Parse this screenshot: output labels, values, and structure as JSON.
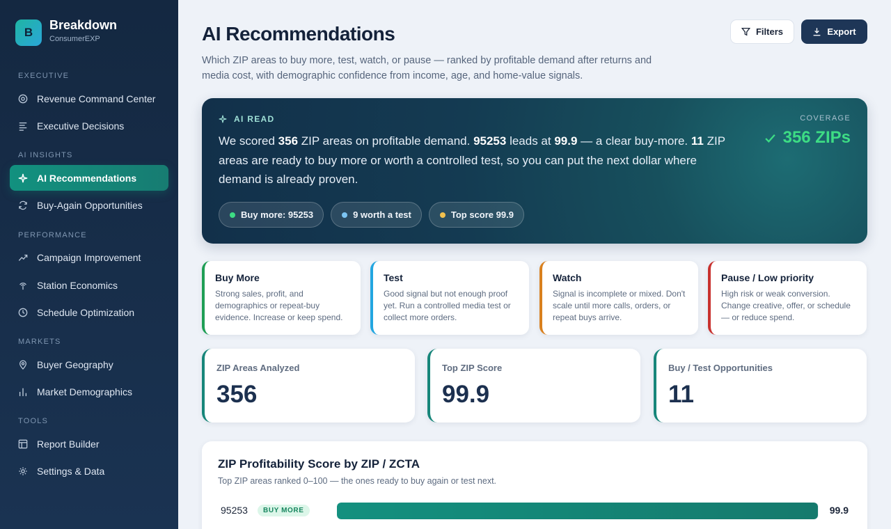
{
  "brand": {
    "initial": "B",
    "name": "Breakdown",
    "sub": "ConsumerEXP"
  },
  "nav": {
    "sections": [
      "Executive",
      "AI Insights",
      "Performance",
      "Markets",
      "Tools"
    ],
    "items": [
      {
        "label": "Revenue Command Center",
        "icon": "target-icon"
      },
      {
        "label": "Executive Decisions",
        "icon": "list-icon"
      },
      {
        "label": "AI Recommendations",
        "icon": "sparkle-icon",
        "active": true
      },
      {
        "label": "Buy-Again Opportunities",
        "icon": "refresh-icon"
      },
      {
        "label": "Campaign Improvement",
        "icon": "trend-icon"
      },
      {
        "label": "Station Economics",
        "icon": "broadcast-icon"
      },
      {
        "label": "Schedule Optimization",
        "icon": "clock-icon"
      },
      {
        "label": "Buyer Geography",
        "icon": "pin-icon"
      },
      {
        "label": "Market Demographics",
        "icon": "bar-chart-icon"
      },
      {
        "label": "Report Builder",
        "icon": "layout-icon"
      },
      {
        "label": "Settings & Data",
        "icon": "gear-icon"
      }
    ]
  },
  "header": {
    "title": "AI Recommendations",
    "description": "Which ZIP areas to buy more, test, watch, or pause — ranked by profitable demand after returns and media cost, with demographic confidence from income, age, and home-value signals.",
    "filters_label": "Filters",
    "export_label": "Export"
  },
  "ai_read": {
    "label": "AI READ",
    "text": {
      "p1": "We scored ",
      "zips": "356",
      "p2": " ZIP areas on profitable demand. ",
      "lead_zip": "95253",
      "p3": " leads at ",
      "lead_score": "99.9",
      "p4": " — a clear buy-more. ",
      "ready": "11",
      "p5": " ZIP areas are ready to buy more or worth a controlled test, so you can put the next dollar where demand is already proven."
    },
    "coverage_label": "COVERAGE",
    "coverage_value": "356 ZIPs",
    "chips": [
      {
        "label": "Buy more: 95253",
        "color": "#3ddc84"
      },
      {
        "label": "9 worth a test",
        "color": "#7cc4f2"
      },
      {
        "label": "Top score 99.9",
        "color": "#f2c14e"
      }
    ]
  },
  "legend": [
    {
      "title": "Buy More",
      "desc": "Strong sales, profit, and demographics or repeat-buy evidence. Increase or keep spend.",
      "color": "#1f9e55"
    },
    {
      "title": "Test",
      "desc": "Good signal but not enough proof yet. Run a controlled media test or collect more orders.",
      "color": "#22a6e0"
    },
    {
      "title": "Watch",
      "desc": "Signal is incomplete or mixed. Don't scale until more calls, orders, or repeat buys arrive.",
      "color": "#d9801e"
    },
    {
      "title": "Pause / Low priority",
      "desc": "High risk or weak conversion. Change creative, offer, or schedule — or reduce spend.",
      "color": "#c8312e"
    }
  ],
  "kpis": [
    {
      "label": "ZIP Areas Analyzed",
      "value": "356"
    },
    {
      "label": "Top ZIP Score",
      "value": "99.9"
    },
    {
      "label": "Buy / Test Opportunities",
      "value": "11"
    }
  ],
  "score_panel": {
    "title": "ZIP Profitability Score by ZIP / ZCTA",
    "subtitle": "Top ZIP areas ranked 0–100 — the ones ready to buy again or test next.",
    "max": 100,
    "rows": [
      {
        "zip": "95253",
        "badge": "BUY MORE",
        "score": 99.9,
        "score_label": "99.9"
      }
    ]
  }
}
